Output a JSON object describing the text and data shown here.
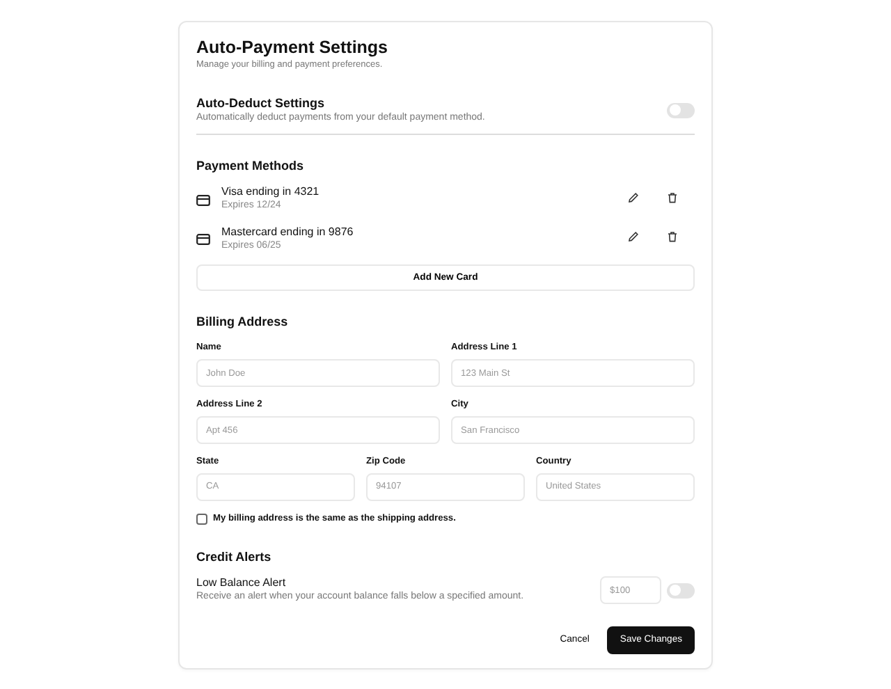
{
  "title": "Auto-Payment Settings",
  "subtitle": "Manage your billing and payment preferences.",
  "auto_deduct": {
    "label": "Auto-Deduct Settings",
    "description": "Automatically deduct payments from your default payment method.",
    "on": false
  },
  "payment_methods": {
    "heading": "Payment Methods",
    "cards": [
      {
        "name": "Visa ending in 4321",
        "expires": "Expires 12/24"
      },
      {
        "name": "Mastercard ending in 9876",
        "expires": "Expires 06/25"
      }
    ],
    "add_button": "Add New Card"
  },
  "billing_address": {
    "heading": "Billing Address",
    "rows": [
      [
        {
          "label": "Name",
          "placeholder": "John Doe"
        },
        {
          "label": "Address Line 1",
          "placeholder": "123 Main St"
        }
      ],
      [
        {
          "label": "Address Line 2",
          "placeholder": "Apt 456"
        },
        {
          "label": "City",
          "placeholder": "San Francisco"
        }
      ],
      [
        {
          "label": "State",
          "placeholder": "CA"
        },
        {
          "label": "Zip Code",
          "placeholder": "94107"
        },
        {
          "label": "Country",
          "placeholder": "United States"
        }
      ]
    ],
    "same_as_shipping": {
      "label": "My billing address is the same as the shipping address.",
      "checked": false
    }
  },
  "credit_alerts": {
    "heading": "Credit Alerts",
    "label": "Low Balance Alert",
    "description": "Receive an alert when your account balance falls below a specified amount.",
    "amount_placeholder": "$100",
    "on": false
  },
  "buttons": {
    "cancel": "Cancel",
    "save": "Save Changes"
  }
}
